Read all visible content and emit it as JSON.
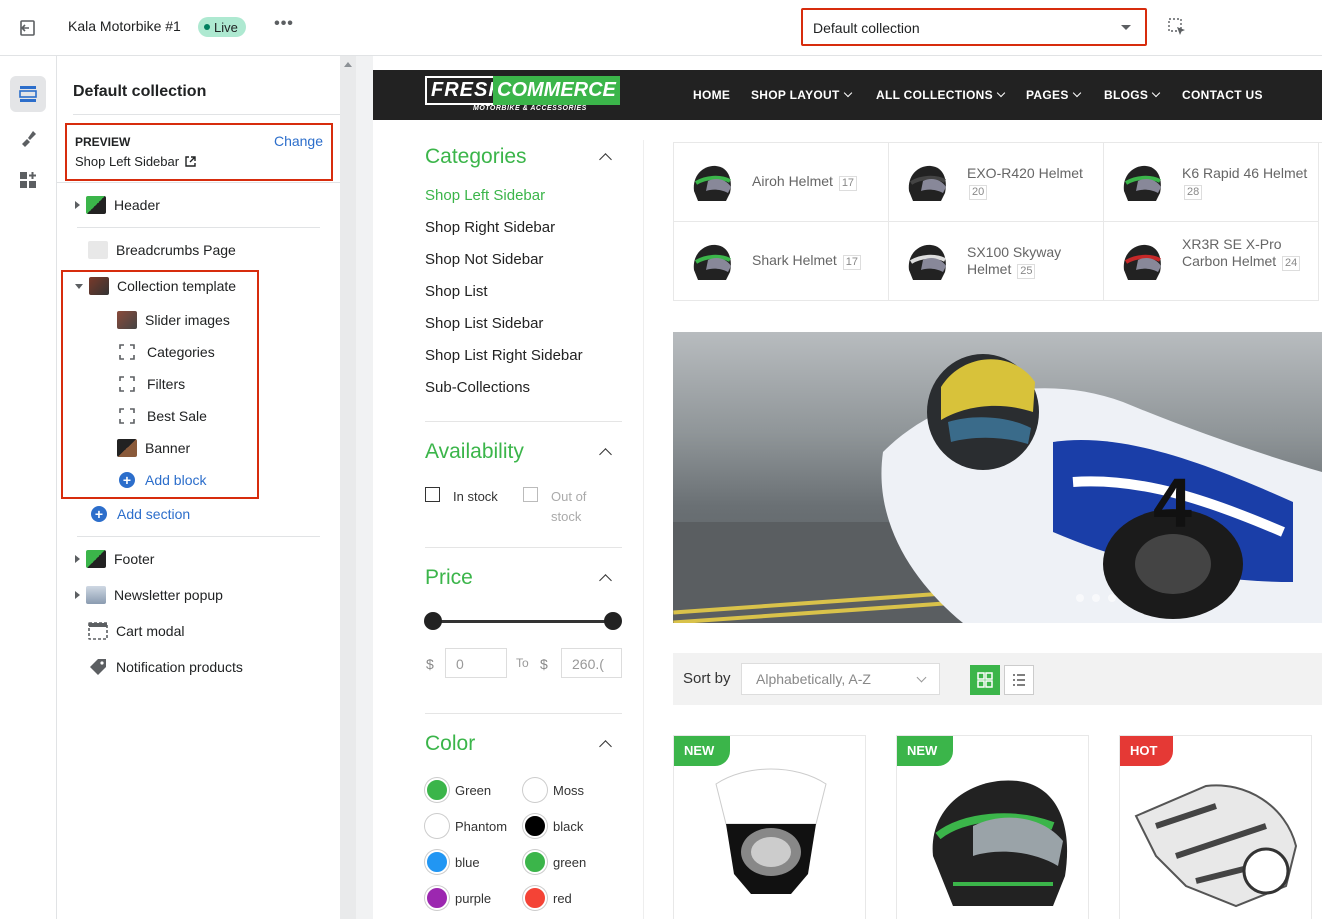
{
  "topbar": {
    "theme_name": "Kala Motorbike #1",
    "live_label": "Live",
    "more_label": "•••",
    "template_select_value": "Default collection"
  },
  "sidebar": {
    "title": "Default collection",
    "preview": {
      "label": "PREVIEW",
      "change_label": "Change",
      "value": "Shop Left Sidebar"
    },
    "sections": {
      "header": "Header",
      "breadcrumbs": "Breadcrumbs Page",
      "collection_template": "Collection template",
      "blocks": [
        "Slider images",
        "Categories",
        "Filters",
        "Best Sale",
        "Banner"
      ],
      "add_block": "Add block",
      "add_section": "Add section",
      "footer": "Footer",
      "newsletter": "Newsletter popup",
      "cart_modal": "Cart modal",
      "notification": "Notification products"
    }
  },
  "store": {
    "logo": {
      "fresh": "FRESH",
      "commerce": "COMMERCE",
      "sub": "MOTORBIKE & ACCESSORIES"
    },
    "nav": [
      "HOME",
      "SHOP LAYOUT",
      "ALL COLLECTIONS",
      "PAGES",
      "BLOGS",
      "CONTACT US"
    ],
    "categories_title": "Categories",
    "categories": [
      "Shop Left Sidebar",
      "Shop Right Sidebar",
      "Shop Not Sidebar",
      "Shop List",
      "Shop List Sidebar",
      "Shop List Right Sidebar",
      "Sub-Collections"
    ],
    "availability_title": "Availability",
    "in_stock": "In stock",
    "out_of_stock_1": "Out of",
    "out_of_stock_2": "stock",
    "price_title": "Price",
    "price_currency": "$",
    "price_from": "0",
    "price_to_label": "To",
    "price_to": "260.(",
    "color_title": "Color",
    "colors": [
      {
        "name": "Green",
        "hex": "#3bb54a"
      },
      {
        "name": "Moss",
        "hex": "#ffffff"
      },
      {
        "name": "Phantom",
        "hex": "#ffffff"
      },
      {
        "name": "black",
        "hex": "#000000"
      },
      {
        "name": "blue",
        "hex": "#2196f3"
      },
      {
        "name": "green",
        "hex": "#3bb54a"
      },
      {
        "name": "purple",
        "hex": "#9c27b0"
      },
      {
        "name": "red",
        "hex": "#f44336"
      }
    ],
    "category_tiles": [
      {
        "name": "Airoh Helmet",
        "count": "17"
      },
      {
        "name": "EXO-R420 Helmet",
        "count": "20"
      },
      {
        "name": "K6 Rapid 46 Helmet",
        "count": "28"
      },
      {
        "name": "Shark Helmet",
        "count": "17"
      },
      {
        "name": "SX100 Skyway Helmet",
        "count": "25"
      },
      {
        "name": "XR3R SE X-Pro Carbon Helmet",
        "count": "24"
      }
    ],
    "sort_label": "Sort by",
    "sort_value": "Alphabetically, A-Z",
    "products": [
      {
        "badge": "NEW"
      },
      {
        "badge": "NEW"
      },
      {
        "badge": "HOT"
      }
    ]
  },
  "colors": {
    "accent": "#3bb54a",
    "highlight": "#d72c0d",
    "link": "#2c6ecb"
  }
}
